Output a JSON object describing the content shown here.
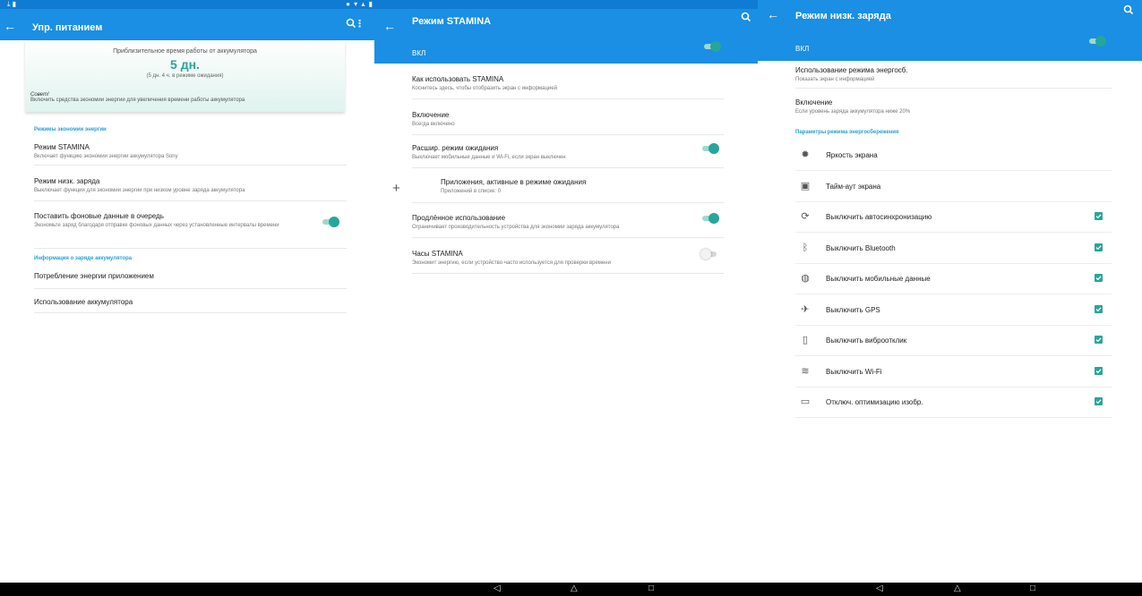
{
  "panel1": {
    "title": "Упр. питанием",
    "battery_summary": {
      "caption": "Приблизительное время работы от аккумулятора",
      "value": "5 дн.",
      "sub": "(5 дн. 4 ч. в режиме ожидания)",
      "tip_title": "Совет!",
      "tip_text": "Включить средства экономии энергии для увеличения времени работы аккумулятора"
    },
    "section_modes": "Режимы экономии энергии",
    "stamina": {
      "title": "Режим STAMINA",
      "sub": "Включает функцию экономии энергии аккумулятора Sony"
    },
    "low_charge": {
      "title": "Режим низк. заряда",
      "sub": "Выключает функции для экономии энергии при низком уровне заряда аккумулятора"
    },
    "queue": {
      "title": "Поставить фоновые данные в очередь",
      "sub": "Экономьте заряд благодаря отправке фоновых данных через установленные интервалы времени",
      "on": true
    },
    "section_info": "Информация о заряде аккумулятора",
    "app_usage": "Потребление энергии приложением",
    "battery_usage": "Использование аккумулятора"
  },
  "panel2": {
    "title": "Режим STAMINA",
    "on_label": "ВКЛ",
    "how_to": {
      "title": "Как использовать STAMINA",
      "sub": "Коснитесь здесь, чтобы отобразить экран с информацией"
    },
    "activation": {
      "title": "Включение",
      "sub": "Всегда включено"
    },
    "ext_standby": {
      "title": "Расшир. режим ожидания",
      "sub": "Выключает мобильные данные и Wi-Fi, если экран выключен",
      "on": true
    },
    "active_apps": {
      "title": "Приложения, активные в режиме ожидания",
      "sub": "Приложений в списке: 0"
    },
    "extended_use": {
      "title": "Продлённое использование",
      "sub": "Ограничивает производительность устройства для экономии заряда аккумулятора",
      "on": true
    },
    "clock": {
      "title": "Часы STAMINA",
      "sub": "Экономит энергию, если устройство часто используется для проверки времени",
      "on": false
    }
  },
  "panel3": {
    "title": "Режим низк. заряда",
    "on_label": "ВКЛ",
    "usage": {
      "title": "Использование режима энергосб.",
      "sub": "Показать экран с информацией"
    },
    "activation": {
      "title": "Включение",
      "sub": "Если уровень заряда аккумулятора ниже 20%"
    },
    "section_params": "Параметры режима энергосбережения",
    "params": [
      {
        "label": "Яркость экрана",
        "icon": "brightness-icon",
        "checked": false
      },
      {
        "label": "Тайм-аут экрана",
        "icon": "screen-timeout-icon",
        "checked": false
      },
      {
        "label": "Выключить автосинхронизацию",
        "icon": "sync-icon",
        "checked": true
      },
      {
        "label": "Выключить Bluetooth",
        "icon": "bluetooth-icon",
        "checked": true
      },
      {
        "label": "Выключить мобильные данные",
        "icon": "globe-icon",
        "checked": true
      },
      {
        "label": "Выключить GPS",
        "icon": "gps-satellite-icon",
        "checked": true
      },
      {
        "label": "Выключить виброотклик",
        "icon": "vibration-icon",
        "checked": true
      },
      {
        "label": "Выключить Wi-Fi",
        "icon": "wifi-icon",
        "checked": true
      },
      {
        "label": "Отключ. оптимизацию изобр.",
        "icon": "phone-icon",
        "checked": true
      }
    ]
  },
  "colors": {
    "accent": "#1a8fe3",
    "toggle_on": "#26a69a",
    "section": "#26a0da"
  }
}
